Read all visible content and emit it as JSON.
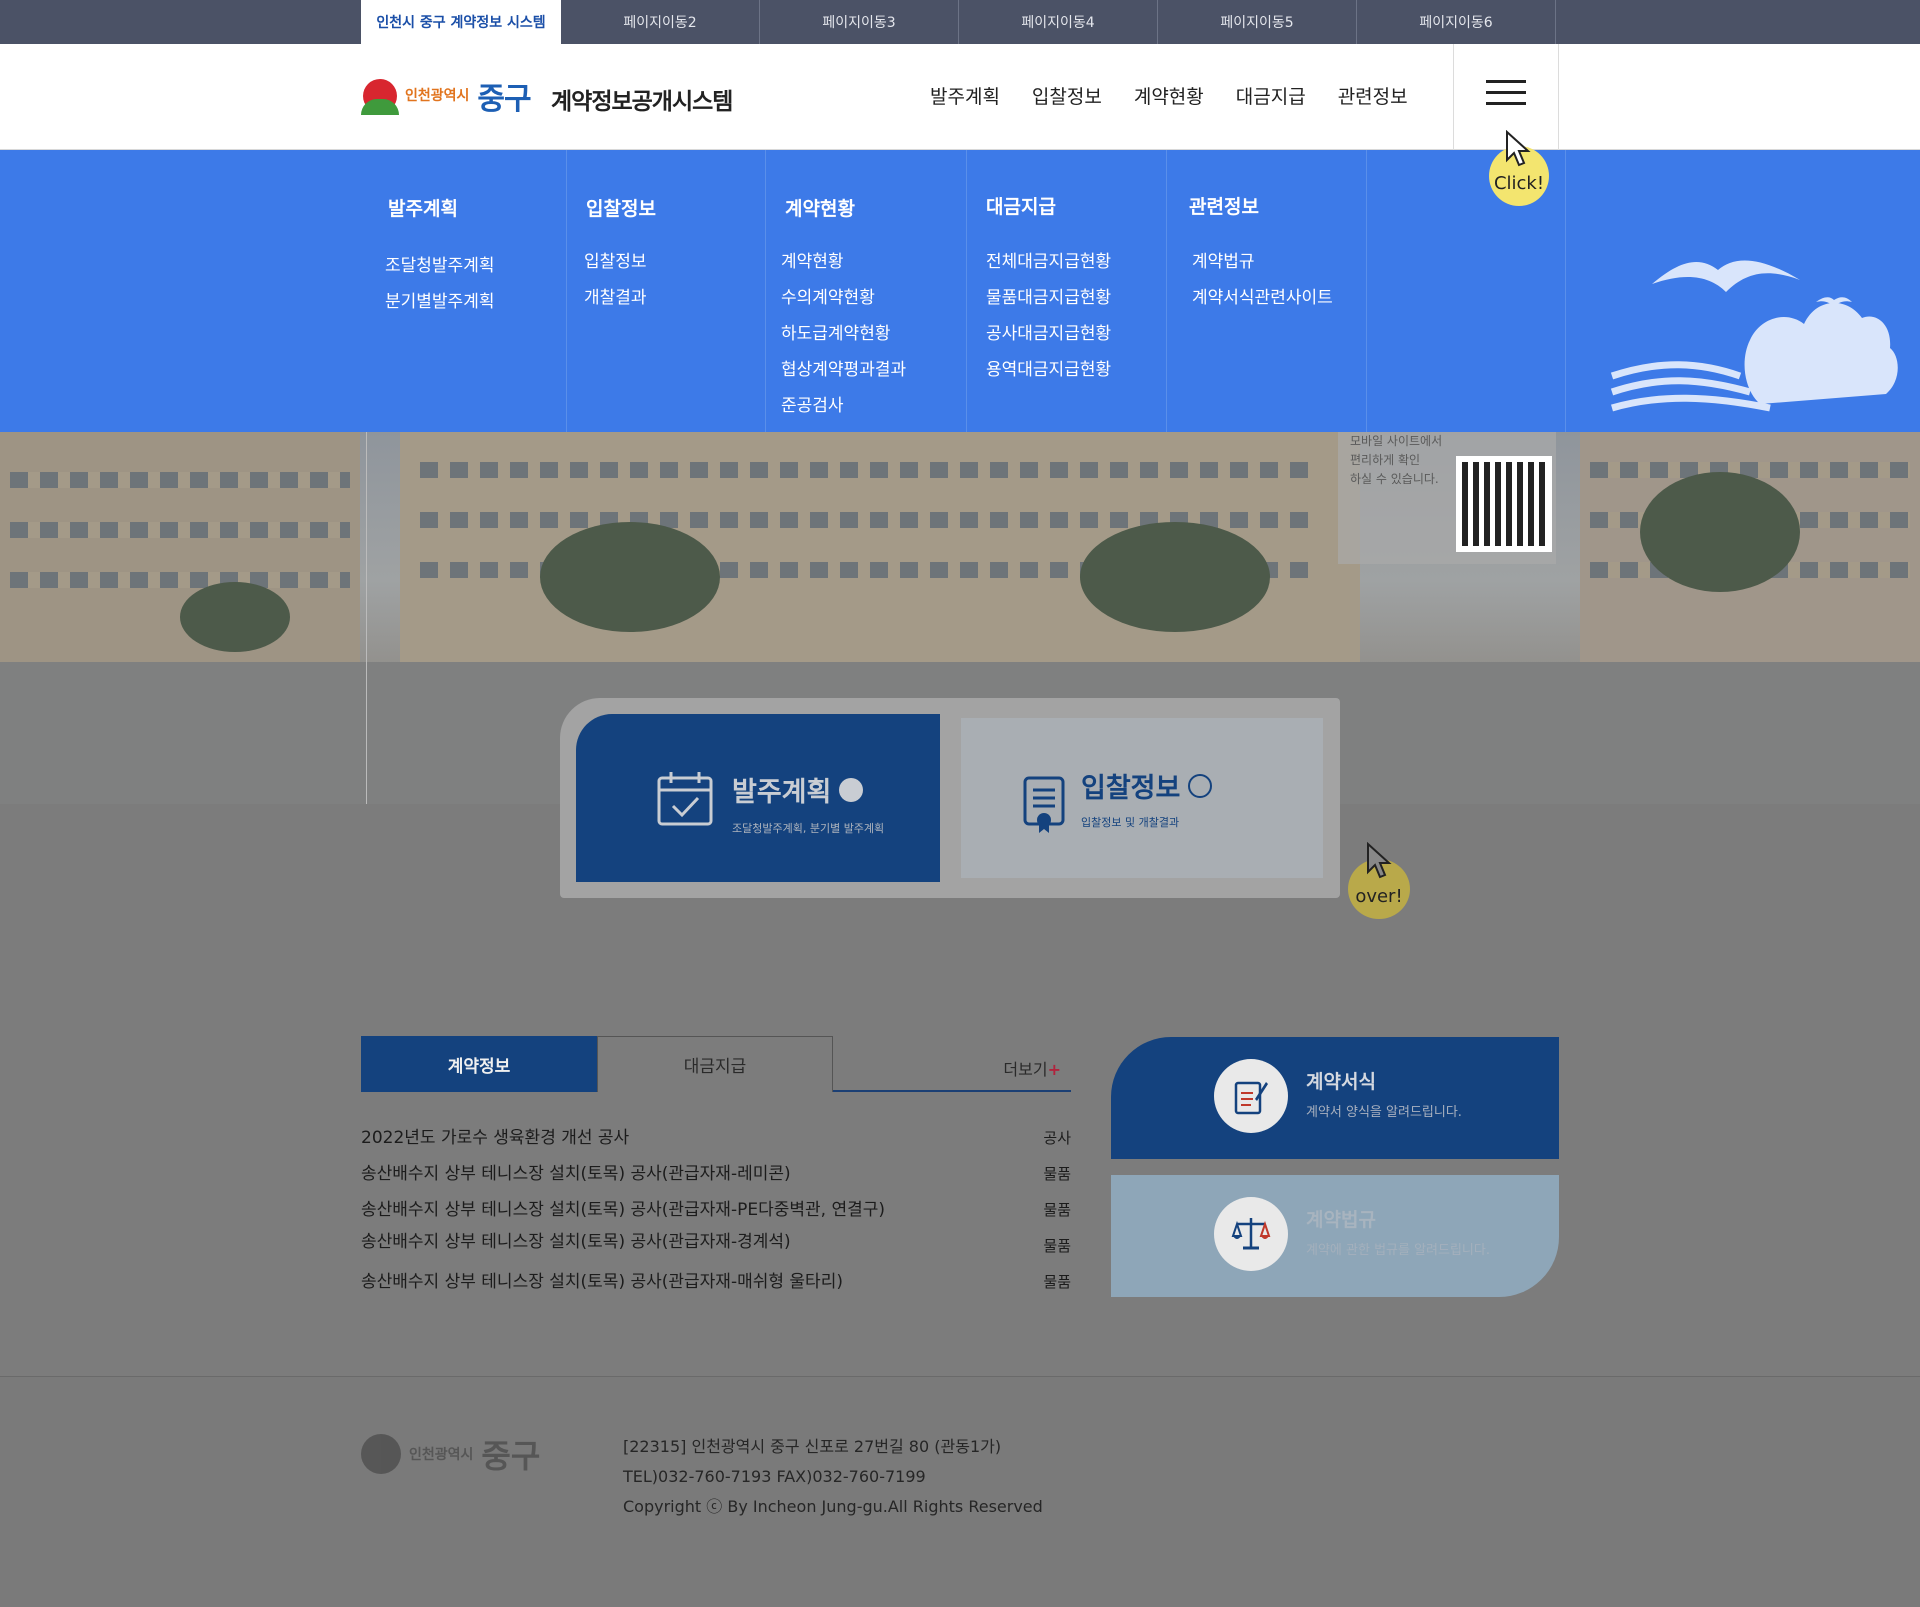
{
  "topbar": {
    "tabs": [
      "인천시 중구 계약정보 시스템",
      "페이지이동2",
      "페이지이동3",
      "페이지이동4",
      "페이지이동5",
      "페이지이동6"
    ]
  },
  "header": {
    "logo_city": "인천광역시",
    "logo_gu": "중구",
    "site_title": "계약정보공개시스템",
    "nav": [
      "발주계획",
      "입찰정보",
      "계약현황",
      "대금지급",
      "관련정보"
    ]
  },
  "mega_menu": {
    "columns": [
      {
        "title": "발주계획",
        "items": [
          "조달청발주계획",
          "분기별발주계획"
        ]
      },
      {
        "title": "입찰정보",
        "items": [
          "입찰정보",
          "개찰결과"
        ]
      },
      {
        "title": "계약현황",
        "items": [
          "계약현황",
          "수의계약현황",
          "하도급계약현황",
          "협상계약평과결과",
          "준공검사"
        ]
      },
      {
        "title": "대금지급",
        "items": [
          "전체대금지급현황",
          "물품대금지급현황",
          "공사대금지급현황",
          "용역대금지급현황"
        ]
      },
      {
        "title": "관련정보",
        "items": [
          "계약법규",
          "계약서식관련사이트"
        ]
      }
    ]
  },
  "hints": {
    "click": "Click!",
    "over": "over!"
  },
  "hero": {
    "qr_text": [
      "모바일 사이트에서",
      "편리하게 확인",
      "하실 수 있습니다."
    ]
  },
  "quick_cards": [
    {
      "title": "발주계획",
      "subtitle": "조달청발주계획, 분기별 발주계획"
    },
    {
      "title": "입찰정보",
      "subtitle": "입찰정보 및 개찰결과"
    }
  ],
  "board": {
    "tabs": [
      "계약정보",
      "대금지급"
    ],
    "more_label": "더보기",
    "more_symbol": "+",
    "items": [
      {
        "title": "2022년도 가로수 생육환경 개선 공사",
        "category": "공사"
      },
      {
        "title": "송산배수지 상부 테니스장 설치(토목) 공사(관급자재-레미콘)",
        "category": "물품"
      },
      {
        "title": "송산배수지 상부 테니스장 설치(토목) 공사(관급자재-PE다중벽관, 연결구)",
        "category": "물품"
      },
      {
        "title": "송산배수지 상부 테니스장 설치(토목) 공사(관급자재-경계석)",
        "category": "물품"
      },
      {
        "title": "송산배수지 상부 테니스장 설치(토목) 공사(관급자재-매쉬형 울타리)",
        "category": "물품"
      }
    ]
  },
  "side_cards": [
    {
      "title": "계약서식",
      "subtitle": "계약서 양식을 알려드립니다."
    },
    {
      "title": "계약법규",
      "subtitle": "계약에 관한 법규를 알려드립니다."
    }
  ],
  "footer": {
    "logo_city": "인천광역시",
    "logo_gu": "중구",
    "address": "[22315] 인천광역시 중구 신포로 27번길 80 (관동1가)",
    "phone": "TEL)032-760-7193 FAX)032-760-7199",
    "copyright": "Copyright ⓒ By Incheon Jung-gu.All Rights Reserved"
  },
  "colors": {
    "topbar": "#4b5266",
    "accent_blue": "#3d7ae8",
    "navy": "#14427e",
    "hint_yellow": "#f3e56f"
  }
}
